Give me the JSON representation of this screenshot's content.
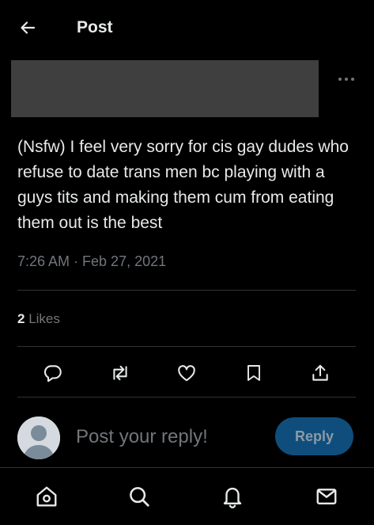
{
  "header": {
    "title": "Post",
    "back_icon": "arrow-left-icon"
  },
  "post": {
    "more_icon": "more-horizontal-icon",
    "text": "(Nsfw) I feel very sorry for cis gay dudes who refuse to date trans men bc playing with a guys tits and making them cum from eating them out is the best",
    "timestamp": "7:26 AM · Feb 27, 2021",
    "likes_count": "2",
    "likes_label": "Likes"
  },
  "actions": [
    {
      "icon": "reply-icon"
    },
    {
      "icon": "repost-icon"
    },
    {
      "icon": "like-icon"
    },
    {
      "icon": "bookmark-icon"
    },
    {
      "icon": "share-icon"
    }
  ],
  "reply": {
    "placeholder": "Post your reply!",
    "button_label": "Reply"
  },
  "bottom_nav": [
    {
      "icon": "home-icon"
    },
    {
      "icon": "search-icon"
    },
    {
      "icon": "notifications-icon"
    },
    {
      "icon": "messages-icon"
    }
  ],
  "colors": {
    "background": "#000000",
    "text_primary": "#e7e9ea",
    "text_secondary": "#71767b",
    "divider": "#2f3336",
    "reply_button": "#0f4e7c",
    "redacted_block": "#3f3f3f"
  }
}
